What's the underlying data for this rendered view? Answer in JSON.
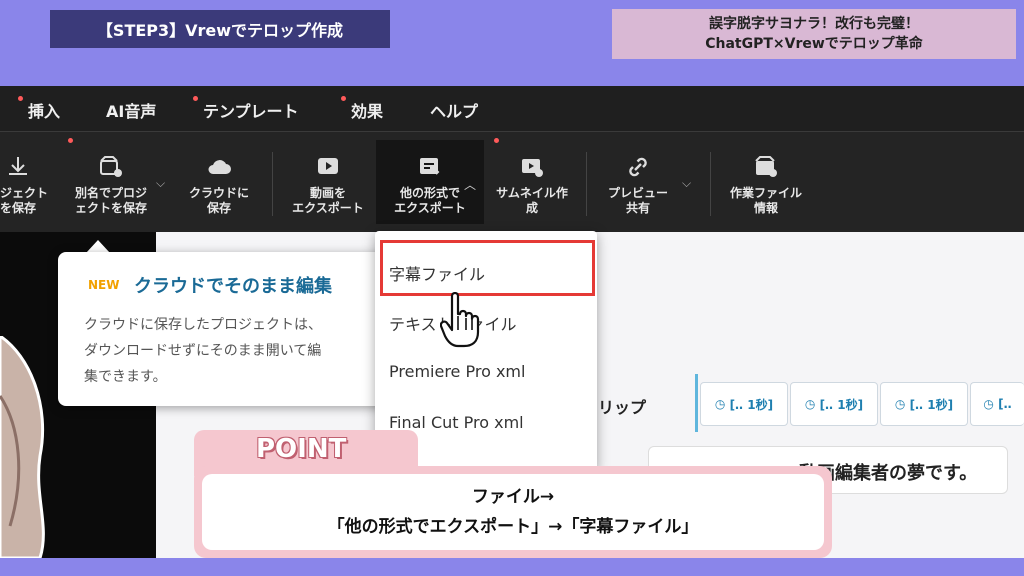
{
  "header": {
    "step_label": "【STEP3】Vrewでテロップ作成",
    "headline_line1": "誤字脱字サヨナラ！改行も完璧！",
    "headline_line2": "ChatGPT×Vrewでテロップ革命"
  },
  "menubar": {
    "items": [
      {
        "label": "挿入",
        "dot": true
      },
      {
        "label": "AI音声",
        "dot": false
      },
      {
        "label": "テンプレート",
        "dot": true
      },
      {
        "label": "効果",
        "dot": true
      },
      {
        "label": "ヘルプ",
        "dot": false
      }
    ]
  },
  "toolbar": {
    "save_project_l1": "ロジェクト",
    "save_project_l2": "を保存",
    "save_as_l1": "別名でプロジ",
    "save_as_l2": "ェクトを保存",
    "cloud_save_l1": "クラウドに",
    "cloud_save_l2": "保存",
    "export_video_l1": "動画を",
    "export_video_l2": "エクスポート",
    "export_other_l1": "他の形式で",
    "export_other_l2": "エクスポート",
    "thumbnail_l1": "サムネイル作",
    "thumbnail_l2": "成",
    "preview_share_l1": "プレビュー",
    "preview_share_l2": "共有",
    "project_info_l1": "作業ファイル",
    "project_info_l2": "情報"
  },
  "tooltip": {
    "badge": "NEW",
    "title": "クラウドでそのまま編集",
    "body_l1": "クラウドに保存したプロジェクトは、",
    "body_l2": "ダウンロードせずにそのまま開いて編",
    "body_l3": "集できます。"
  },
  "dropdown": {
    "items": [
      "字幕ファイル",
      "テキストファイル",
      "Premiere Pro xml",
      "Final Cut Pro xml"
    ]
  },
  "timeline": {
    "clip_label": "リップ",
    "chips": [
      "[‥ 1秒]",
      "[‥ 1秒]",
      "[‥ 1秒]",
      "[‥"
    ],
    "subtitle_text": "動画編集者の夢です。"
  },
  "callout": {
    "tag": "POINT",
    "line1": "ファイル→",
    "line2": "「他の形式でエクスポート」→「字幕ファイル」"
  },
  "colors": {
    "background": "#8a85ea",
    "step_label_bg": "#3b3a7a",
    "headline_bg": "#d9b8d4",
    "highlight": "#e53935",
    "callout": "#f5c7cf",
    "accent_blue": "#1a6a96"
  }
}
